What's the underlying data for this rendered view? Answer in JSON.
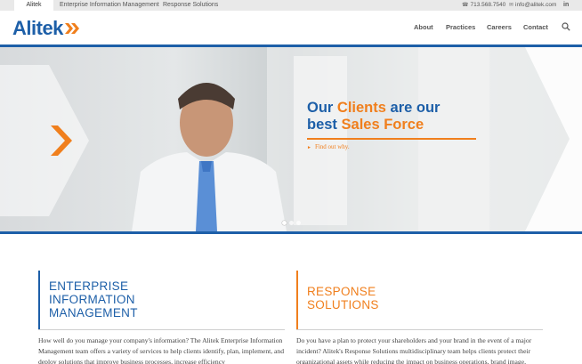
{
  "topbar": {
    "tabs": [
      "Alitek",
      "Enterprise Information Management",
      "Response Solutions"
    ],
    "phone": "713.568.7540",
    "email": "info@alitek.com",
    "phone_icon": "phone-icon",
    "email_icon": "envelope-icon",
    "social_icon": "linkedin-icon",
    "social_label": "in"
  },
  "header": {
    "logo_text": "Alitek",
    "nav": [
      "About",
      "Practices",
      "Careers",
      "Contact"
    ],
    "search_icon": "search-icon"
  },
  "hero": {
    "headline_line1_a": "Our ",
    "headline_line1_b": "Clients",
    "headline_line1_c": " are our",
    "headline_line2_a": "best ",
    "headline_line2_b": "Sales Force",
    "cta": "Find out why.",
    "slides": 3,
    "active_slide": 1
  },
  "sections": {
    "eim": {
      "title_lines": [
        "ENTERPRISE",
        "INFORMATION",
        "MANAGEMENT"
      ],
      "text": "How well do you manage your company's information? The Alitek Enterprise Information Management team offers a variety of services to help clients identify, plan, implement, and deploy solutions that improve business processes, increase efficiency"
    },
    "rs": {
      "title_lines": [
        "RESPONSE",
        "SOLUTIONS"
      ],
      "text": "Do you have a plan to protect your shareholders and your brand in the event of a major incident? Alitek's Response Solutions multidisciplinary team helps clients protect their organizational assets while reducing the impact on business operations, brand image,"
    }
  },
  "colors": {
    "brand_blue": "#1d5fa8",
    "brand_orange": "#f07f1d"
  }
}
